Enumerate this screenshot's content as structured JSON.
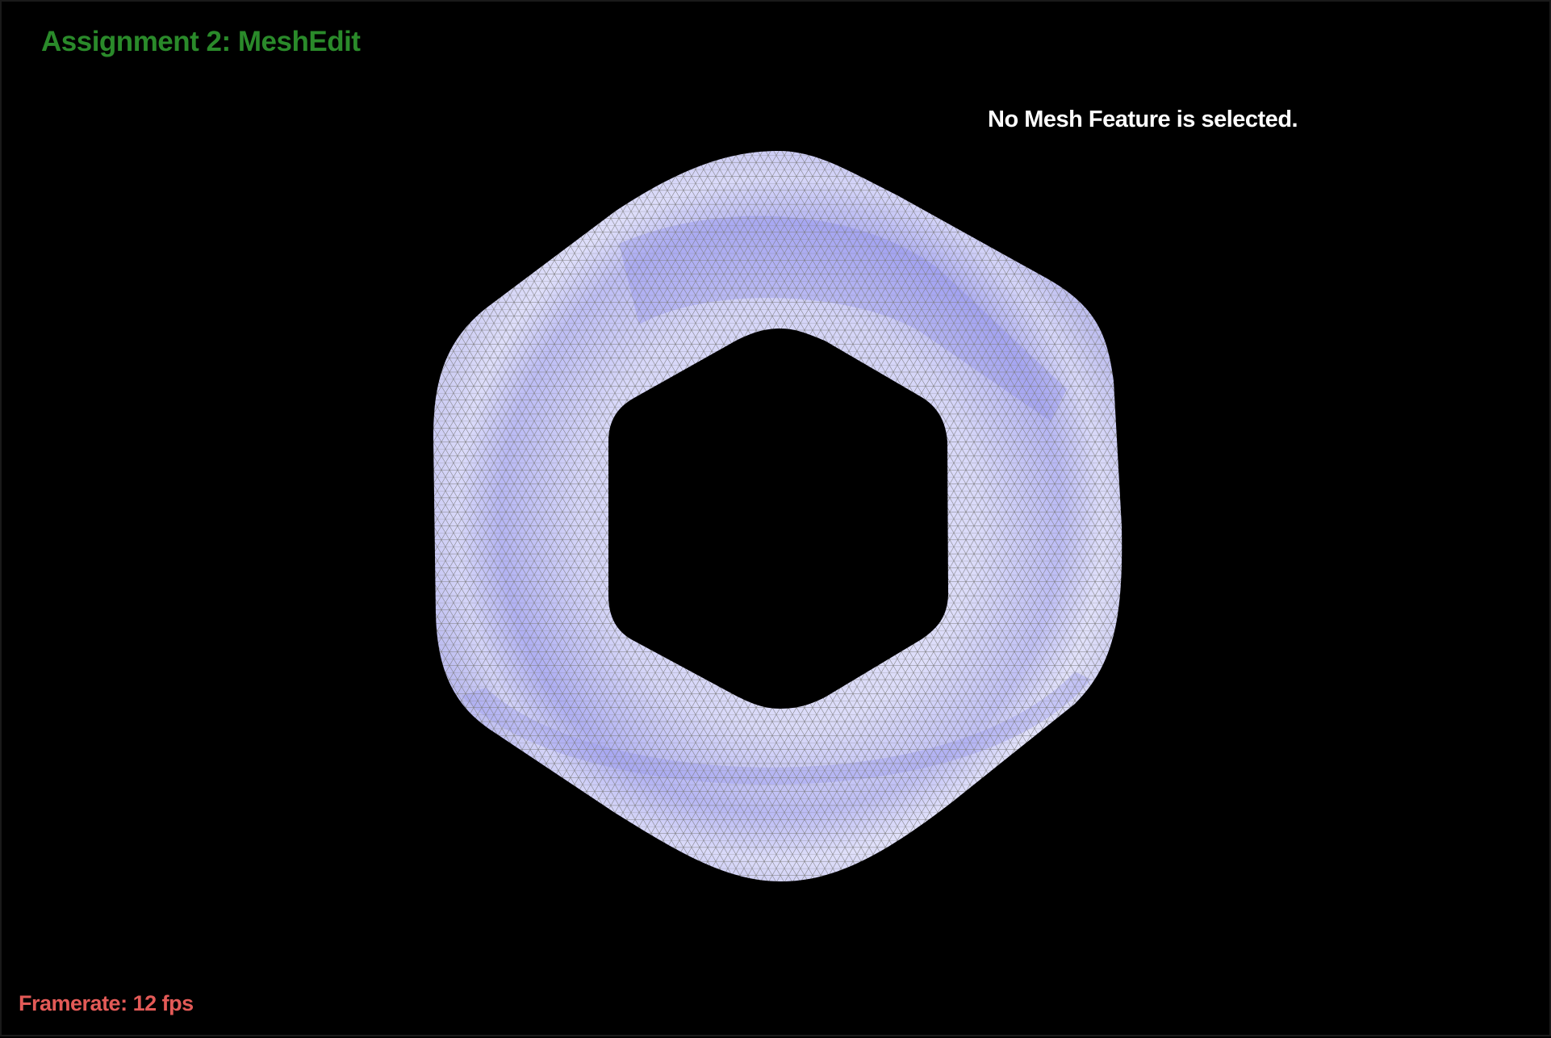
{
  "window": {
    "title": "Assignment 2: MeshEdit"
  },
  "hud": {
    "selection_status": "No Mesh Feature is selected.",
    "framerate_label": "Framerate:",
    "framerate_value": "12",
    "framerate_unit": "fps"
  },
  "colors": {
    "background": "#000000",
    "title": "#2a8a2a",
    "status_text": "#ffffff",
    "framerate": "#e35a57",
    "mesh_fill": "#a6a6f2",
    "mesh_highlight": "#f2f2ff",
    "mesh_wire": "#8a8a8a"
  },
  "scene": {
    "object": "hexagonal-torus-mesh",
    "render_mode": "shaded-wireframe"
  }
}
